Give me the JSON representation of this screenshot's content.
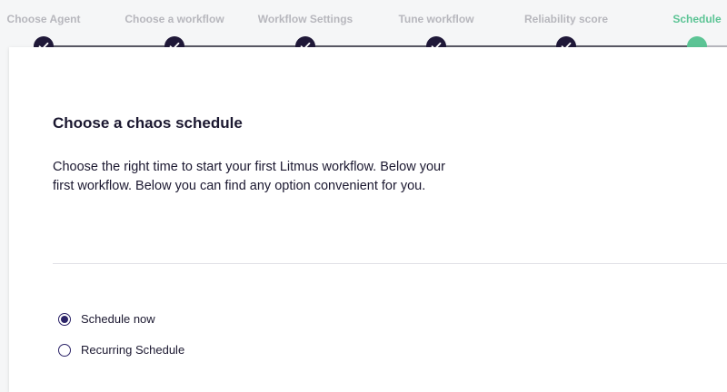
{
  "stepper": {
    "steps": [
      {
        "label": "Choose Agent",
        "status": "completed"
      },
      {
        "label": "Choose a workflow",
        "status": "completed"
      },
      {
        "label": "Workflow Settings",
        "status": "completed"
      },
      {
        "label": "Tune workflow",
        "status": "completed"
      },
      {
        "label": "Reliability score",
        "status": "completed"
      },
      {
        "label": "Schedule",
        "status": "active"
      }
    ],
    "colors": {
      "completed": "#1f1838",
      "active": "#5cc495",
      "inactive_label": "#b7b7bd"
    },
    "check_icon": "check-icon"
  },
  "content": {
    "title": "Choose a chaos schedule",
    "description": "Choose the right time to start your first Litmus workflow. Below your first workflow. Below you can find any option convenient for you."
  },
  "schedule_options": [
    {
      "label": "Schedule now",
      "selected": true
    },
    {
      "label": "Recurring Schedule",
      "selected": false
    }
  ]
}
